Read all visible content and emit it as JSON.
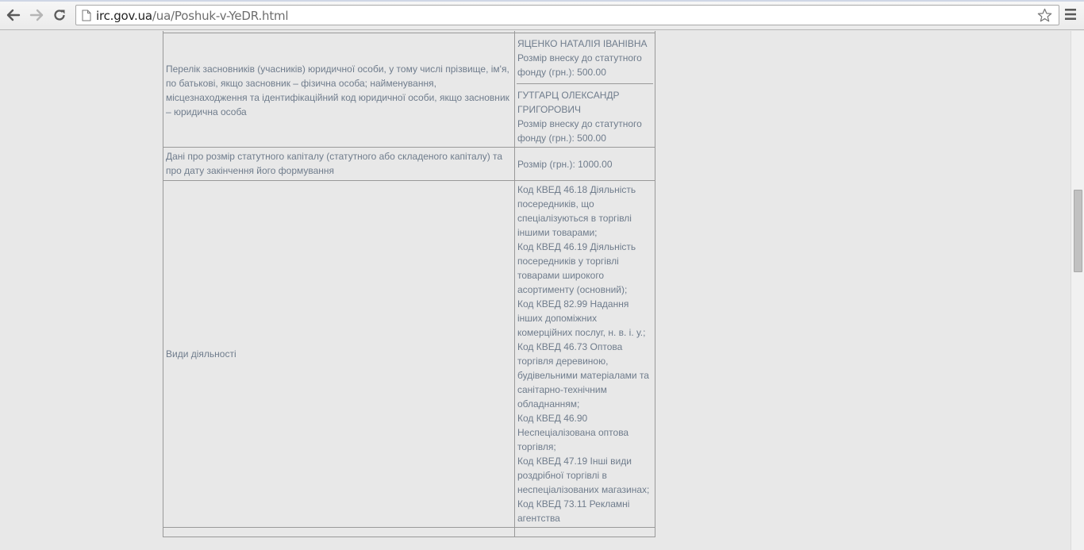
{
  "browser": {
    "url_domain": "irc.gov.ua",
    "url_path": "/ua/Poshuk-v-YeDR.html"
  },
  "rows": {
    "founders": {
      "label": "Перелік засновників (учасників) юридичної особи, у тому числі прізвище, ім'я, по батькові, якщо засновник – фізична особа; найменування, місцезнаходження та ідентифікаційний код юридичної особи, якщо засновник – юридична особа",
      "items": [
        {
          "name": "ЯЦЕНКО НАТАЛІЯ ІВАНІВНА",
          "contribution": "Розмір внеску до статутного фонду (грн.): 500.00"
        },
        {
          "name": "ГУТГАРЦ ОЛЕКСАНДР ГРИГОРОВИЧ",
          "contribution": "Розмір внеску до статутного фонду (грн.): 500.00"
        }
      ]
    },
    "capital": {
      "label": "Дані про розмір статутного капіталу (статутного або складеного капіталу) та про дату закінчення його формування",
      "value": "Розмір (грн.): 1000.00"
    },
    "activities": {
      "label": "Види діяльності",
      "items": [
        "Код КВЕД 46.18 Діяльність посередників, що спеціалізуються в торгівлі іншими товарами;",
        "Код КВЕД 46.19 Діяльність посередників у торгівлі товарами широкого асортименту (основний);",
        "Код КВЕД 82.99 Надання інших допоміжних комерційних послуг, н. в. і. у.;",
        "Код КВЕД 46.73 Оптова торгівля деревиною, будівельними матеріалами та санітарно-технічним обладнанням;",
        "Код КВЕД 46.90 Неспеціалізована оптова торгівля;",
        "Код КВЕД 47.19 Інші види роздрібної торгівлі в неспеціалізованих магазинах;",
        "Код КВЕД 73.11 Рекламні агентства"
      ]
    }
  },
  "icons": {
    "back": "back-arrow-icon",
    "forward": "forward-arrow-icon",
    "reload": "reload-icon",
    "page": "page-icon",
    "star": "star-icon",
    "menu": "hamburger-menu-icon"
  }
}
